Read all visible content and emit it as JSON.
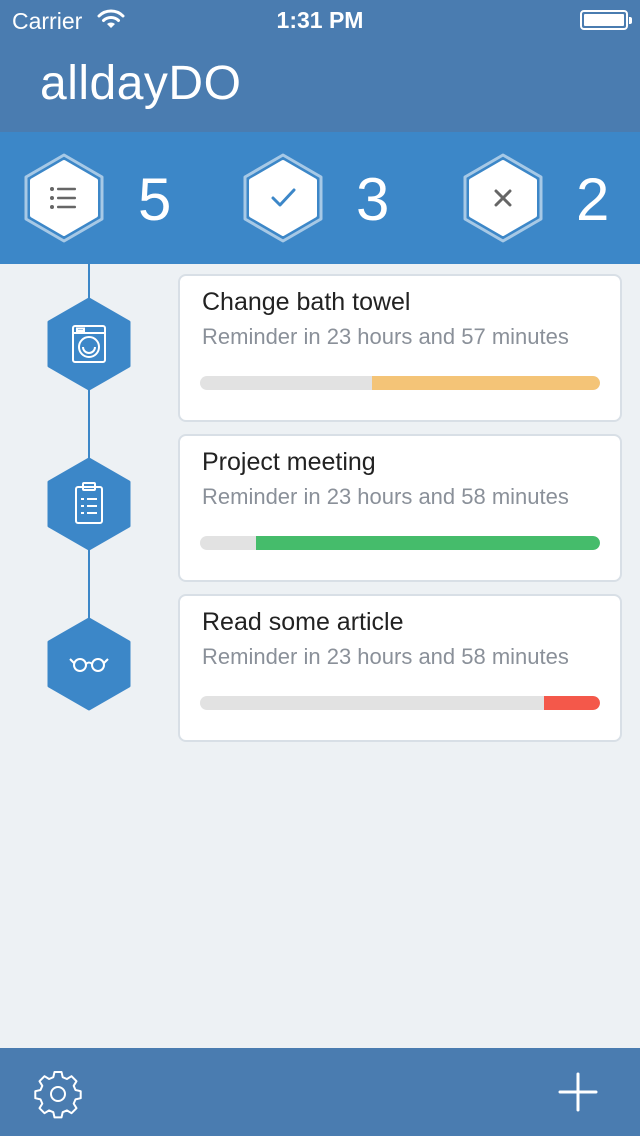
{
  "status_bar": {
    "carrier": "Carrier",
    "time": "1:31 PM"
  },
  "app": {
    "title": "alldayDO"
  },
  "stats": [
    {
      "icon": "list-icon",
      "count": "5"
    },
    {
      "icon": "check-icon",
      "count": "3"
    },
    {
      "icon": "x-icon",
      "count": "2"
    }
  ],
  "tasks": [
    {
      "icon": "washing-machine-icon",
      "title": "Change bath towel",
      "subtitle": "Reminder in 23 hours and 57 minutes",
      "progress": 0.57,
      "color": "#f4c477"
    },
    {
      "icon": "clipboard-icon",
      "title": "Project meeting",
      "subtitle": "Reminder in 23 hours and 58 minutes",
      "progress": 0.86,
      "color": "#45bc6b"
    },
    {
      "icon": "glasses-icon",
      "title": "Read some article",
      "subtitle": "Reminder in 23 hours and 58 minutes",
      "progress": 0.14,
      "color": "#f4584a"
    }
  ],
  "colors": {
    "header": "#4a7cb0",
    "stats_bar": "#3c87c8",
    "background": "#edf1f4"
  }
}
